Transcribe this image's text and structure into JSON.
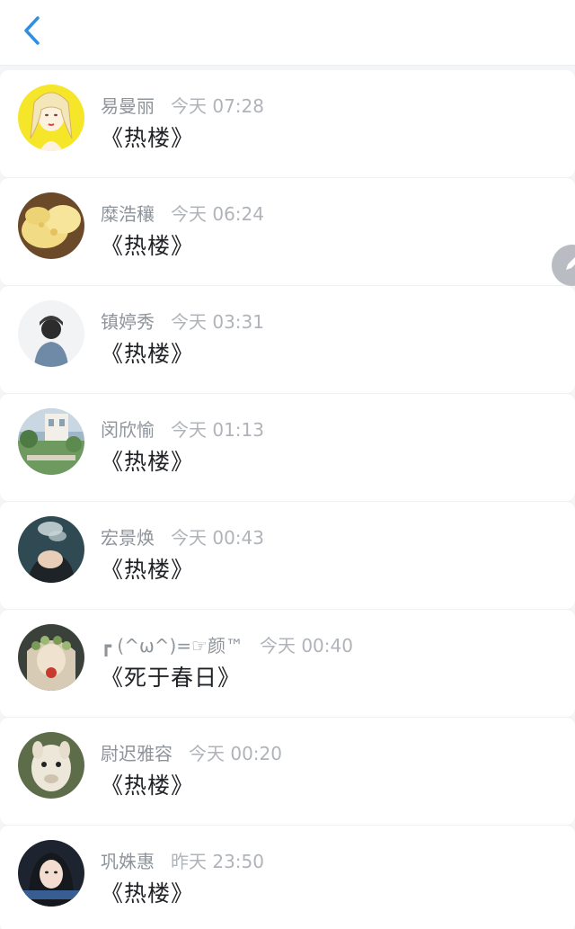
{
  "header": {
    "back_icon": "chevron-left-icon"
  },
  "fab": {
    "icon": "edit-pencil-icon"
  },
  "items": [
    {
      "name": "易曼丽",
      "time": "今天 07:28",
      "title": "《热楼》",
      "avatar_theme": "yellow-illustration"
    },
    {
      "name": "糜浩穰",
      "time": "今天 06:24",
      "title": "《热楼》",
      "avatar_theme": "bread"
    },
    {
      "name": "镇婷秀",
      "time": "今天 03:31",
      "title": "《热楼》",
      "avatar_theme": "person-back"
    },
    {
      "name": "闵欣愉",
      "time": "今天 01:13",
      "title": "《热楼》",
      "avatar_theme": "garden"
    },
    {
      "name": "宏景焕",
      "time": "今天 00:43",
      "title": "《热楼》",
      "avatar_theme": "smoke"
    },
    {
      "name": "┏ (^ω^)=☞颜™",
      "time": "今天 00:40",
      "title": "《死于春日》",
      "avatar_theme": "flower-crown"
    },
    {
      "name": "尉迟雅容",
      "time": "今天 00:20",
      "title": "《热楼》",
      "avatar_theme": "alpaca"
    },
    {
      "name": "巩姝惠",
      "time": "昨天 23:50",
      "title": "《热楼》",
      "avatar_theme": "girl-portrait"
    }
  ],
  "colors": {
    "accent": "#2f8fe0",
    "title_text": "#1f2125",
    "meta_text": "#9aa0a6"
  }
}
